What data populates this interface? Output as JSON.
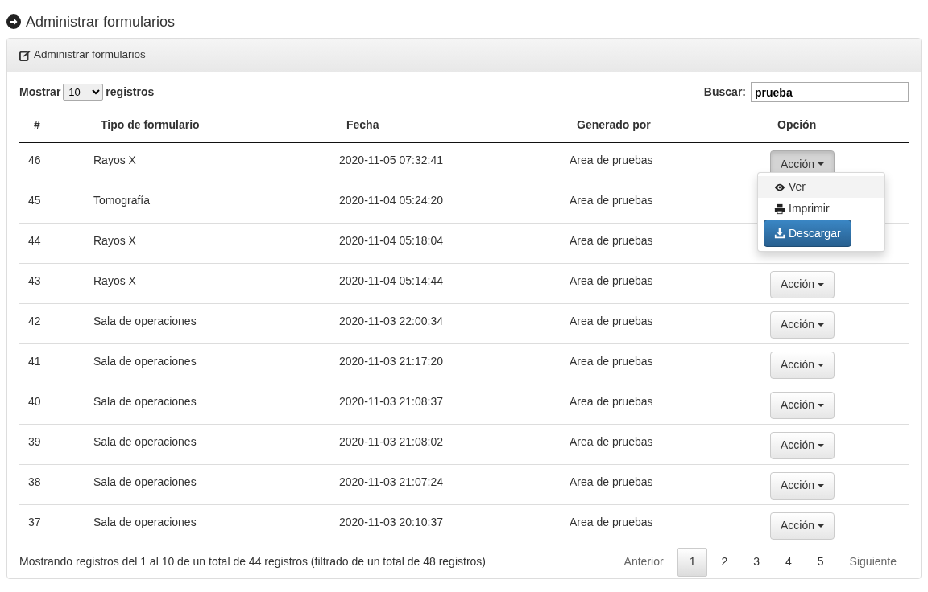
{
  "page_title": "Administrar formularios",
  "panel": {
    "title": "Administrar formularios"
  },
  "length": {
    "label_before": "Mostrar",
    "value": "10",
    "label_after": "registros"
  },
  "search": {
    "label": "Buscar:",
    "value": "prueba"
  },
  "table": {
    "columns": [
      "#",
      "Tipo de formulario",
      "Fecha",
      "Generado por",
      "Opción"
    ],
    "rows": [
      {
        "id": "46",
        "type": "Rayos X",
        "date": "2020-11-05 07:32:41",
        "by": "Area de pruebas",
        "action": {
          "label": "Acción",
          "expanded": true
        }
      },
      {
        "id": "45",
        "type": "Tomografía",
        "date": "2020-11-04 05:24:20",
        "by": "Area de pruebas"
      },
      {
        "id": "44",
        "type": "Rayos X",
        "date": "2020-11-04 05:18:04",
        "by": "Area de pruebas"
      },
      {
        "id": "43",
        "type": "Rayos X",
        "date": "2020-11-04 05:14:44",
        "by": "Area de pruebas",
        "action": {
          "label": "Acción",
          "expanded": false
        }
      },
      {
        "id": "42",
        "type": "Sala de operaciones",
        "date": "2020-11-03 22:00:34",
        "by": "Area de pruebas",
        "action": {
          "label": "Acción",
          "expanded": false
        }
      },
      {
        "id": "41",
        "type": "Sala de operaciones",
        "date": "2020-11-03 21:17:20",
        "by": "Area de pruebas",
        "action": {
          "label": "Acción",
          "expanded": false
        }
      },
      {
        "id": "40",
        "type": "Sala de operaciones",
        "date": "2020-11-03 21:08:37",
        "by": "Area de pruebas",
        "action": {
          "label": "Acción",
          "expanded": false
        }
      },
      {
        "id": "39",
        "type": "Sala de operaciones",
        "date": "2020-11-03 21:08:02",
        "by": "Area de pruebas",
        "action": {
          "label": "Acción",
          "expanded": false
        }
      },
      {
        "id": "38",
        "type": "Sala de operaciones",
        "date": "2020-11-03 21:07:24",
        "by": "Area de pruebas",
        "action": {
          "label": "Acción",
          "expanded": false
        }
      },
      {
        "id": "37",
        "type": "Sala de operaciones",
        "date": "2020-11-03 20:10:37",
        "by": "Area de pruebas",
        "action": {
          "label": "Acción",
          "expanded": false
        }
      }
    ]
  },
  "menu": [
    {
      "label": "Ver",
      "kind": "view",
      "hovered": true,
      "active": false
    },
    {
      "label": "Imprimir",
      "kind": "print",
      "hovered": false,
      "active": false
    },
    {
      "label": "Descargar",
      "kind": "download",
      "hovered": false,
      "active": true
    }
  ],
  "info": "Mostrando registros del 1 al 10 de un total de 44 registros (filtrado de un total de 48 registros)",
  "pagination": [
    {
      "label": "Anterior",
      "kind": "nav",
      "selected": false
    },
    {
      "label": "1",
      "kind": "page",
      "selected": true
    },
    {
      "label": "2",
      "kind": "page",
      "selected": false
    },
    {
      "label": "3",
      "kind": "page",
      "selected": false
    },
    {
      "label": "4",
      "kind": "page",
      "selected": false
    },
    {
      "label": "5",
      "kind": "page",
      "selected": false
    },
    {
      "label": "Siguiente",
      "kind": "nav",
      "selected": false
    }
  ]
}
